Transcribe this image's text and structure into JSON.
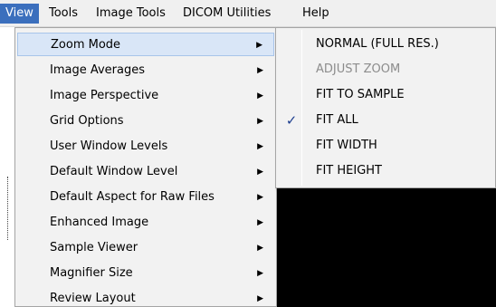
{
  "menubar": {
    "items": [
      {
        "label": "View",
        "active": true
      },
      {
        "label": "Tools"
      },
      {
        "label": "Image Tools"
      },
      {
        "label": "DICOM Utilities"
      },
      {
        "label": "Help"
      }
    ]
  },
  "view_menu": {
    "items": [
      {
        "label": "Zoom Mode",
        "has_submenu": true,
        "highlighted": true
      },
      {
        "label": "Image Averages",
        "has_submenu": true
      },
      {
        "label": "Image Perspective",
        "has_submenu": true
      },
      {
        "label": "Grid Options",
        "has_submenu": true
      },
      {
        "label": "User Window Levels",
        "has_submenu": true
      },
      {
        "label": "Default Window Level",
        "has_submenu": true
      },
      {
        "label": "Default Aspect for Raw Files",
        "has_submenu": true
      },
      {
        "label": "Enhanced Image",
        "has_submenu": true
      },
      {
        "label": "Sample Viewer",
        "has_submenu": true
      },
      {
        "label": "Magnifier Size",
        "has_submenu": true
      },
      {
        "label": "Review Layout",
        "has_submenu": true
      }
    ],
    "submenu_arrow": "▶"
  },
  "zoom_submenu": {
    "items": [
      {
        "label": "NORMAL (FULL RES.)"
      },
      {
        "label": "ADJUST ZOOM",
        "disabled": true
      },
      {
        "label": "FIT TO SAMPLE"
      },
      {
        "label": "FIT ALL",
        "checked": true
      },
      {
        "label": "FIT WIDTH"
      },
      {
        "label": "FIT HEIGHT"
      }
    ],
    "check_glyph": "✓"
  },
  "colors": {
    "menubar_bg": "#f0f0f0",
    "active_menu_bg": "#3b6fbd",
    "menu_bg": "#f2f2f2",
    "highlight_bg": "#d9e6f7",
    "highlight_border": "#a8c5ea",
    "disabled_text": "#8c8c8c",
    "content_bg": "#000000"
  }
}
